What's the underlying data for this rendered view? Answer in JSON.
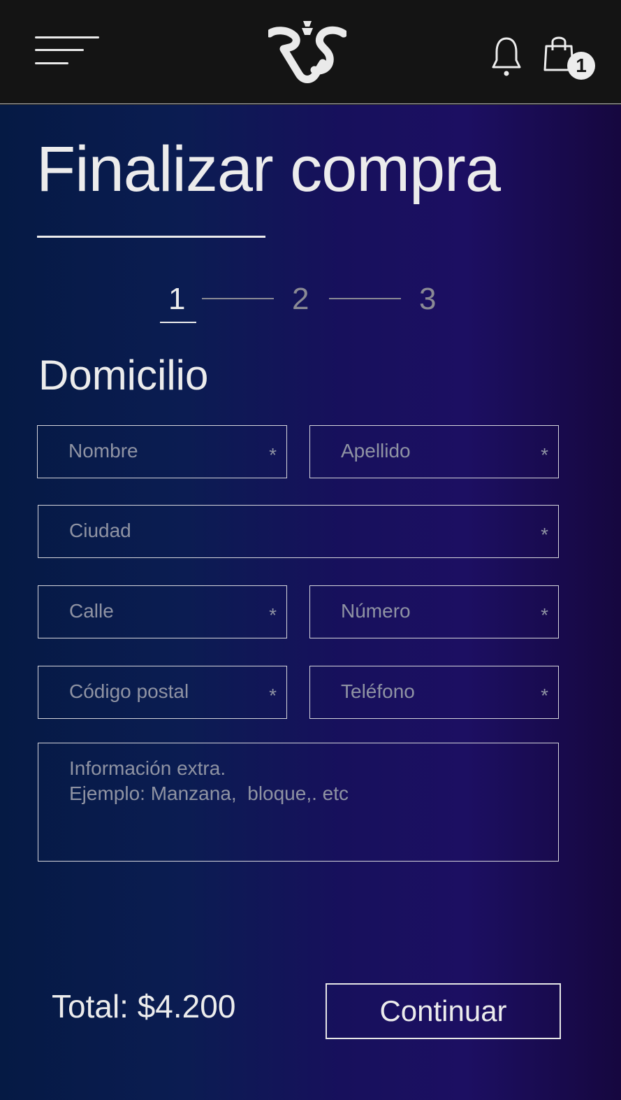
{
  "header": {
    "cart_count": "1"
  },
  "page": {
    "title": "Finalizar compra",
    "steps": [
      "1",
      "2",
      "3"
    ],
    "active_step": 1,
    "section_title": "Domicilio"
  },
  "form": {
    "nombre_placeholder": "Nombre",
    "apellido_placeholder": "Apellido",
    "ciudad_placeholder": "Ciudad",
    "calle_placeholder": "Calle",
    "numero_placeholder": "Número",
    "codigo_postal_placeholder": "Código postal",
    "telefono_placeholder": "Teléfono",
    "extra_placeholder_line1": "Información extra.",
    "extra_placeholder_line2": "Ejemplo: Manzana,  bloque,. etc",
    "required_mark": "*"
  },
  "footer": {
    "total": "Total: $4.200",
    "continue_label": "Continuar"
  },
  "icons": {
    "menu": "hamburger-menu-icon",
    "logo": "brand-logo",
    "bell": "bell-icon",
    "cart": "shopping-bag-icon"
  },
  "colors": {
    "header_bg": "#141414",
    "gradient_start": "#051a44",
    "gradient_end": "#16073f",
    "text": "#ececec",
    "placeholder": "#8f93a3"
  }
}
